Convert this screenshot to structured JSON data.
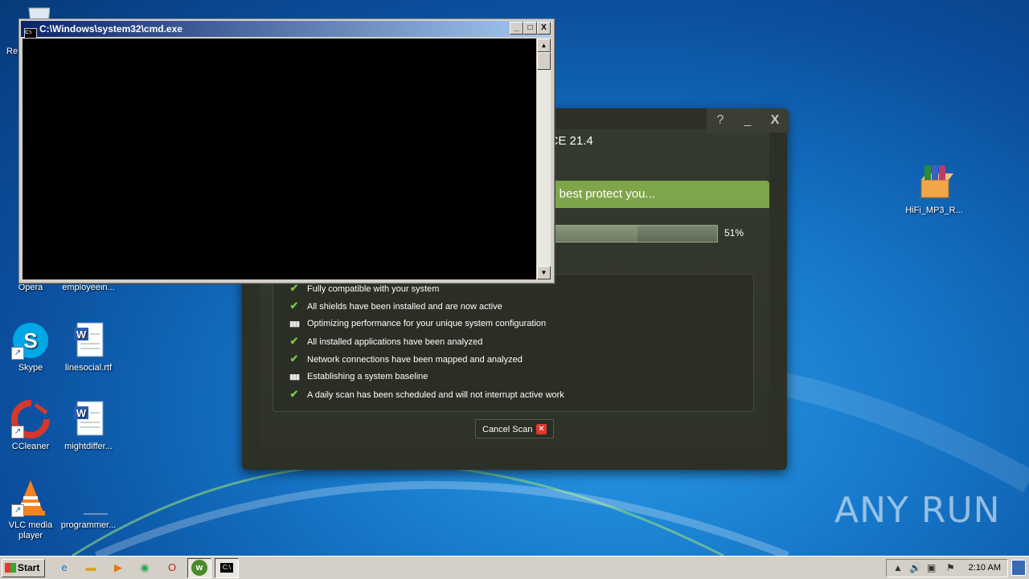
{
  "desktop_icons": [
    {
      "id": "recycle",
      "label": "Re"
    },
    {
      "id": "opera",
      "label": "Opera"
    },
    {
      "id": "employee",
      "label": "employeein..."
    },
    {
      "id": "skype",
      "label": "Skype"
    },
    {
      "id": "linesocial",
      "label": "linesocial.rtf"
    },
    {
      "id": "ccleaner",
      "label": "CCleaner"
    },
    {
      "id": "mightdiffer",
      "label": "mightdiffer..."
    },
    {
      "id": "vlc",
      "label": "VLC media player"
    },
    {
      "id": "programmer",
      "label": "programmer..."
    },
    {
      "id": "hifi",
      "label": "HiFi_MP3_R..."
    }
  ],
  "av_window": {
    "title": "e CE 21.4",
    "help_label": "?",
    "minimize_label": "_",
    "close_label": "X",
    "banner": "to best protect you...",
    "progress_percent": 51,
    "progress_label": "51%",
    "items": [
      {
        "status": "done",
        "text": "Fully compatible with your system"
      },
      {
        "status": "done",
        "text": "All shields have been installed and are now active"
      },
      {
        "status": "busy",
        "text": "Optimizing performance for your unique system configuration"
      },
      {
        "status": "done",
        "text": "All installed applications have been analyzed"
      },
      {
        "status": "done",
        "text": "Network connections have been mapped and analyzed"
      },
      {
        "status": "busy",
        "text": "Establishing a system baseline"
      },
      {
        "status": "done",
        "text": "A daily scan has been scheduled and will not interrupt active work"
      }
    ],
    "cancel_label": "Cancel Scan"
  },
  "cmd_window": {
    "title": "C:\\Windows\\system32\\cmd.exe",
    "minimize_label": "_",
    "maximize_label": "□",
    "close_label": "X"
  },
  "taskbar": {
    "start_label": "Start",
    "clock": "2:10 AM"
  },
  "watermark": "ANY RUN",
  "colors": {
    "accent_green": "#7fa54a",
    "check_green": "#7ec246",
    "cancel_red": "#d93a2f"
  }
}
